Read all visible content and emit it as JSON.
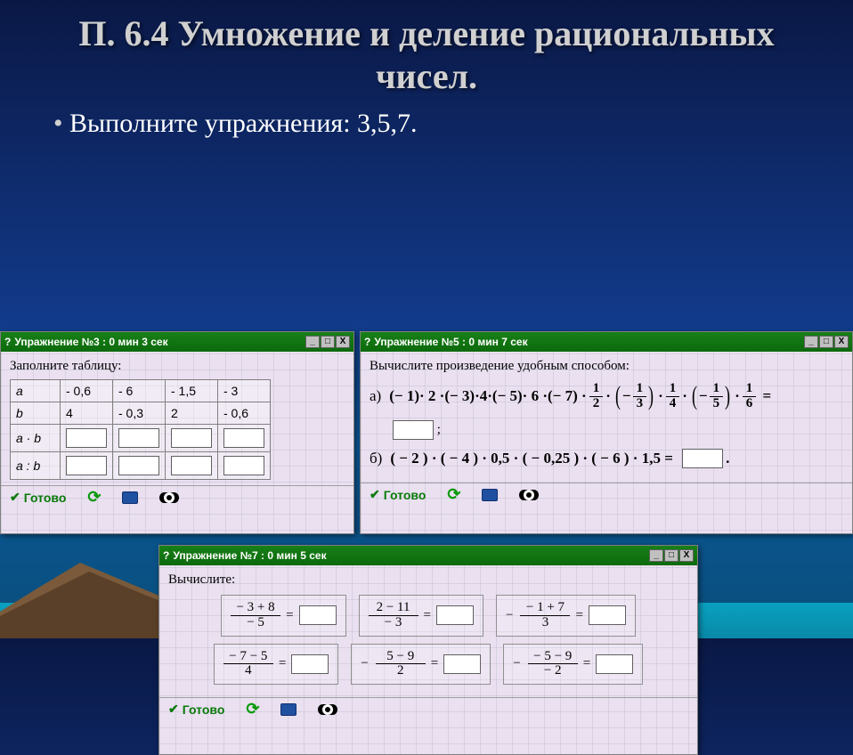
{
  "slide": {
    "title": "П. 6.4 Умножение и деление рациональных чисел.",
    "bullet": "Выполните упражнения: 3,5,7."
  },
  "controls": {
    "ready": "Готово",
    "min": "_",
    "max": "□",
    "close": "X"
  },
  "w1": {
    "title": "Упражнение №3 : 0 мин  3 сек",
    "prompt": "Заполните таблицу:",
    "rows": {
      "a_label": "a",
      "b_label": "b",
      "ab_label": "a · b",
      "adb_label": "a : b",
      "a": [
        "- 0,6",
        "- 6",
        "- 1,5",
        "- 3"
      ],
      "b": [
        "4",
        "- 0,3",
        "2",
        "- 0,6"
      ]
    }
  },
  "w2": {
    "title": "Упражнение №5 : 0 мин  7 сек",
    "prompt": "Вычислите произведение удобным способом:",
    "a_label": "а)",
    "b_label": "б)",
    "b_expr": "( − 2 ) · ( − 4 ) · 0,5 · ( − 0,25 ) · ( − 6 ) · 1,5  ="
  },
  "w3": {
    "title": "Упражнение №7 : 0 мин  5 сек",
    "prompt": "Вычислите:",
    "cells": [
      {
        "pre": "",
        "num": "− 3 + 8",
        "den": "− 5"
      },
      {
        "pre": "",
        "num": "2 − 11",
        "den": "− 3"
      },
      {
        "pre": "−",
        "num": "− 1 + 7",
        "den": "3"
      },
      {
        "pre": "",
        "num": "− 7 − 5",
        "den": "4"
      },
      {
        "pre": "−",
        "num": "5 − 9",
        "den": "2"
      },
      {
        "pre": "−",
        "num": "− 5 − 9",
        "den": "− 2"
      }
    ]
  }
}
